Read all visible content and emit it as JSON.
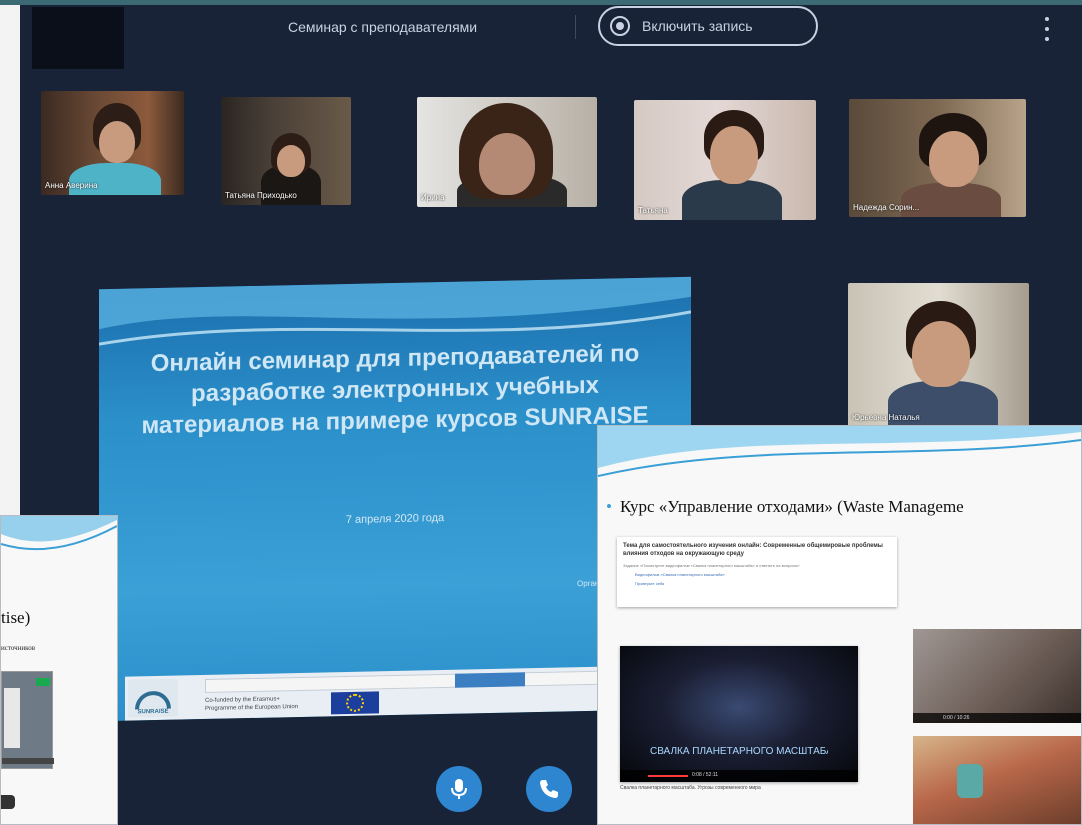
{
  "call": {
    "title": "Семинар с преподавателями",
    "record_label": "Включить запись",
    "participants": [
      {
        "name": "Анна Аверина"
      },
      {
        "name": "Татьяна Приходько"
      },
      {
        "name": "Ирина"
      },
      {
        "name": "Татьяна"
      },
      {
        "name": "Надежда Сорин..."
      },
      {
        "name": "Юрьевна Наталья"
      }
    ]
  },
  "presentation": {
    "title": "Онлайн семинар для преподавателей по разработке электронных учебных материалов на примере курсов SUNRAISE",
    "date": "7 апреля 2020 года",
    "organizer": "Организатор - Журавлева Е.",
    "logo_text": "SUNRAISE",
    "funding_text": "Co-funded by the Erasmus+ Programme of the European Union"
  },
  "left_slide": {
    "title_fragment": "tise)",
    "subtitle_fragment": "источников"
  },
  "right_slide": {
    "heading": "Курс «Управление отходами» (Waste Manageme",
    "topic_title": "Тема для самостоятельного изучения онлайн: Современные общемировые проблемы влияния отходов на окружающую среду",
    "topic_line": "Задание «Посмотрите видеофильм «Свалка планетарного масштаба» и ответьте на вопросы»",
    "topic_links": [
      "Видеофильм «Свалка планетарного масштаба»",
      "Проверьте себя"
    ],
    "video_banner": "СВАЛКА ПЛАНЕТАРНОГО МАСШТАБА",
    "video_time": "0:08 / 52:11",
    "video_caption": "Свалка планетарного масштаба. Угрозы современного мира",
    "small_video_time": "0:00 / 10:26"
  },
  "colors": {
    "call_background": "#182338",
    "control_blue": "#2f86d0",
    "slide_blue": "#2b8fc9",
    "accent": "#3a9fd6"
  },
  "icons": {
    "record": "record-icon",
    "menu": "more-vertical-icon",
    "mic": "microphone-icon",
    "phone": "phone-icon"
  }
}
